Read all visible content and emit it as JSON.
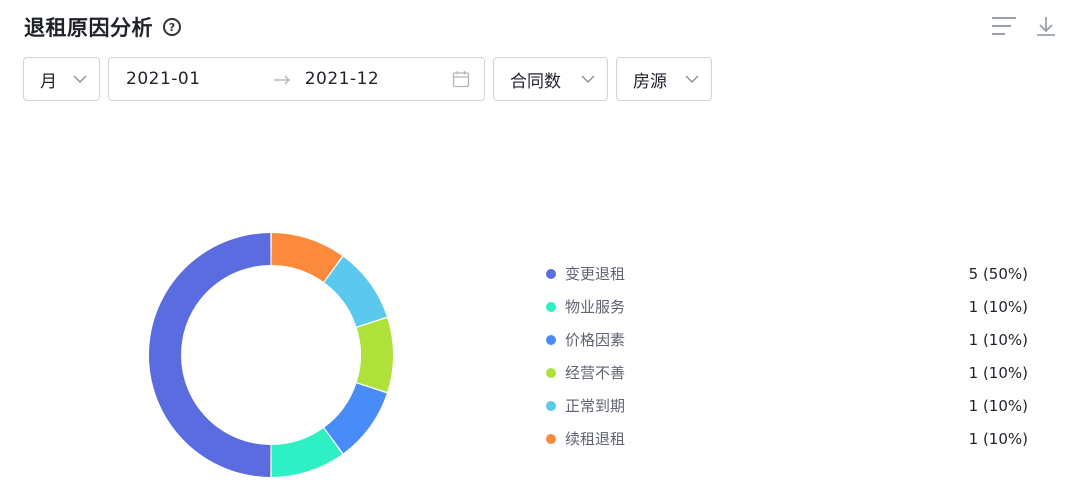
{
  "header": {
    "title": "退租原因分析",
    "help_icon": "question-circle-icon"
  },
  "toolbar": {
    "list_icon": "list-icon",
    "download_icon": "download-icon"
  },
  "filters": {
    "period": "月",
    "date_start": "2021-01",
    "date_end": "2021-12",
    "metric": "合同数",
    "dimension": "房源"
  },
  "chart_data": {
    "type": "pie",
    "donut": true,
    "title": "退租原因分析",
    "categories": [
      "变更退租",
      "物业服务",
      "价格因素",
      "经营不善",
      "正常到期",
      "续租退租"
    ],
    "values": [
      5,
      1,
      1,
      1,
      1,
      1
    ],
    "percent": [
      "50%",
      "10%",
      "10%",
      "10%",
      "10%",
      "10%"
    ],
    "colors": [
      "#5b6ce0",
      "#2ef0c4",
      "#4a8cf7",
      "#aee23a",
      "#5bc8ee",
      "#fb8a3c"
    ],
    "legend": "right",
    "labels": [
      "5 (50%)",
      "1 (10%)",
      "1 (10%)",
      "1 (10%)",
      "1 (10%)",
      "1 (10%)"
    ]
  }
}
